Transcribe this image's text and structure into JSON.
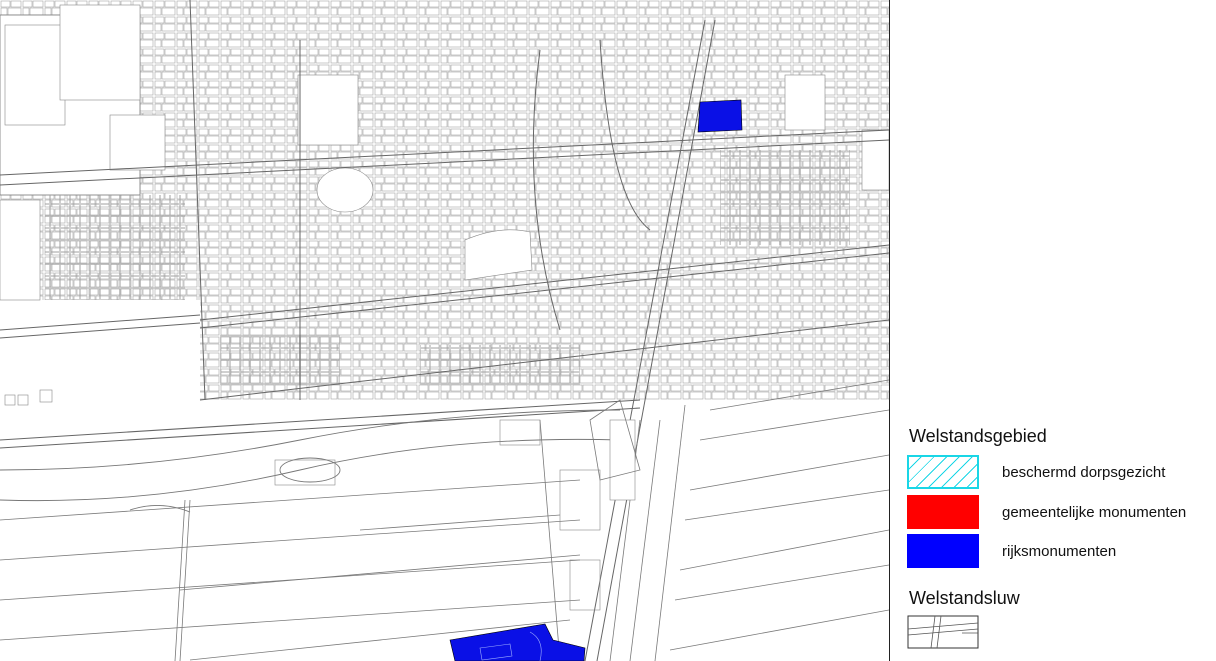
{
  "map": {
    "description_layer": "cadastral street map",
    "line_color": "#8a8a8a",
    "highlight_color": "#0a10e6"
  },
  "legend": {
    "section1_title": "Welstandsgebied",
    "items": [
      {
        "label": "beschermd dorpsgezicht",
        "swatch": "hatch-cyan",
        "color": "#19d6e6"
      },
      {
        "label": "gemeentelijke monumenten",
        "swatch": "solid",
        "color": "#ff0000"
      },
      {
        "label": "rijksmonumenten",
        "swatch": "solid",
        "color": "#0000ff"
      }
    ],
    "section2_title": "Welstandsluw",
    "luw_item": {
      "swatch": "outline-lines",
      "color": "#333333"
    }
  }
}
